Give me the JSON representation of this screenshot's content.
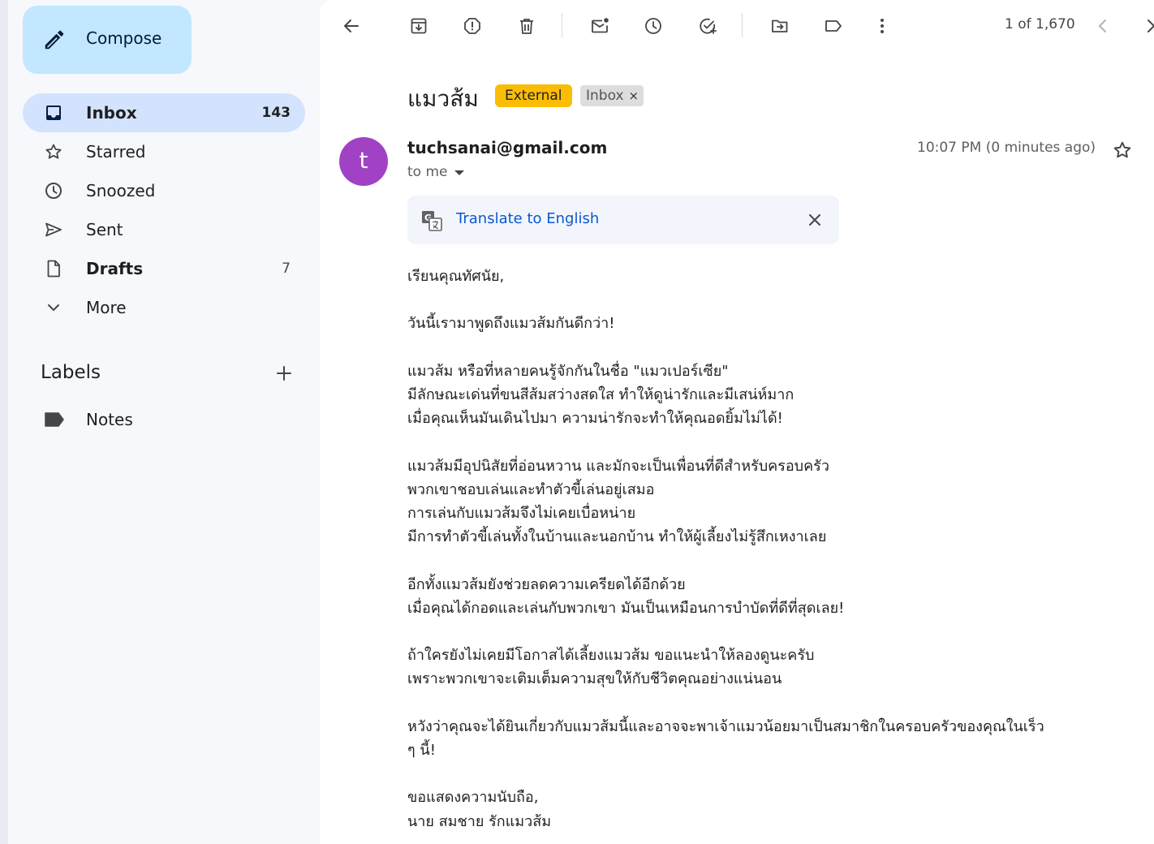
{
  "sidebar": {
    "compose_label": "Compose",
    "items": [
      {
        "label": "Inbox",
        "count": "143"
      },
      {
        "label": "Starred",
        "count": ""
      },
      {
        "label": "Snoozed",
        "count": ""
      },
      {
        "label": "Sent",
        "count": ""
      },
      {
        "label": "Drafts",
        "count": "7"
      },
      {
        "label": "More",
        "count": ""
      }
    ],
    "labels_heading": "Labels",
    "labels": [
      {
        "label": "Notes"
      }
    ]
  },
  "toolbar": {
    "pager": "1 of 1,670"
  },
  "email": {
    "subject": "แมวส้ม",
    "badges": {
      "external": "External",
      "inbox": "Inbox",
      "inbox_remove": "×"
    },
    "avatar_letter": "t",
    "avatar_color": "#a142c5",
    "sender": "tuchsanai@gmail.com",
    "to": "to me",
    "timestamp": "10:07 PM (0 minutes ago)",
    "translate_link": "Translate to English",
    "body": "เรียนคุณทัศนัย,\n\nวันนี้เรามาพูดถึงแมวส้มกันดีกว่า!\n\nแมวส้ม หรือที่หลายคนรู้จักกันในชื่อ \"แมวเปอร์เซีย\"\nมีลักษณะเด่นที่ขนสีส้มสว่างสดใส ทำให้ดูน่ารักและมีเสน่ห์มาก\nเมื่อคุณเห็นมันเดินไปมา ความน่ารักจะทำให้คุณอดยิ้มไม่ได้!\n\nแมวส้มมีอุปนิสัยที่อ่อนหวาน และมักจะเป็นเพื่อนที่ดีสำหรับครอบครัว\nพวกเขาชอบเล่นและทำตัวขี้เล่นอยู่เสมอ\nการเล่นกับแมวส้มจึงไม่เคยเบื่อหน่าย\nมีการทำตัวขี้เล่นทั้งในบ้านและนอกบ้าน ทำให้ผู้เลี้ยงไม่รู้สึกเหงาเลย\n\nอีกทั้งแมวส้มยังช่วยลดความเครียดได้อีกด้วย\nเมื่อคุณได้กอดและเล่นกับพวกเขา มันเป็นเหมือนการบำบัดที่ดีที่สุดเลย!\n\nถ้าใครยังไม่เคยมีโอกาสได้เลี้ยงแมวส้ม ขอแนะนำให้ลองดูนะครับ\nเพราะพวกเขาจะเติมเต็มความสุขให้กับชีวิตคุณอย่างแน่นอน\n\nหวังว่าคุณจะได้ยินเกี่ยวกับแมวส้มนี้และอาจจะพาเจ้าแมวน้อยมาเป็นสมาชิกในครอบครัวของคุณในเร็ว\nๆ นี้!\n\nขอแสดงความนับถือ,\nนาย สมชาย รักแมวส้ม"
  },
  "colors": {
    "accent": "#0b57d0",
    "active_nav": "#d3e3fd",
    "compose_bg": "#c2e7ff",
    "external_badge": "#fbbc04"
  }
}
